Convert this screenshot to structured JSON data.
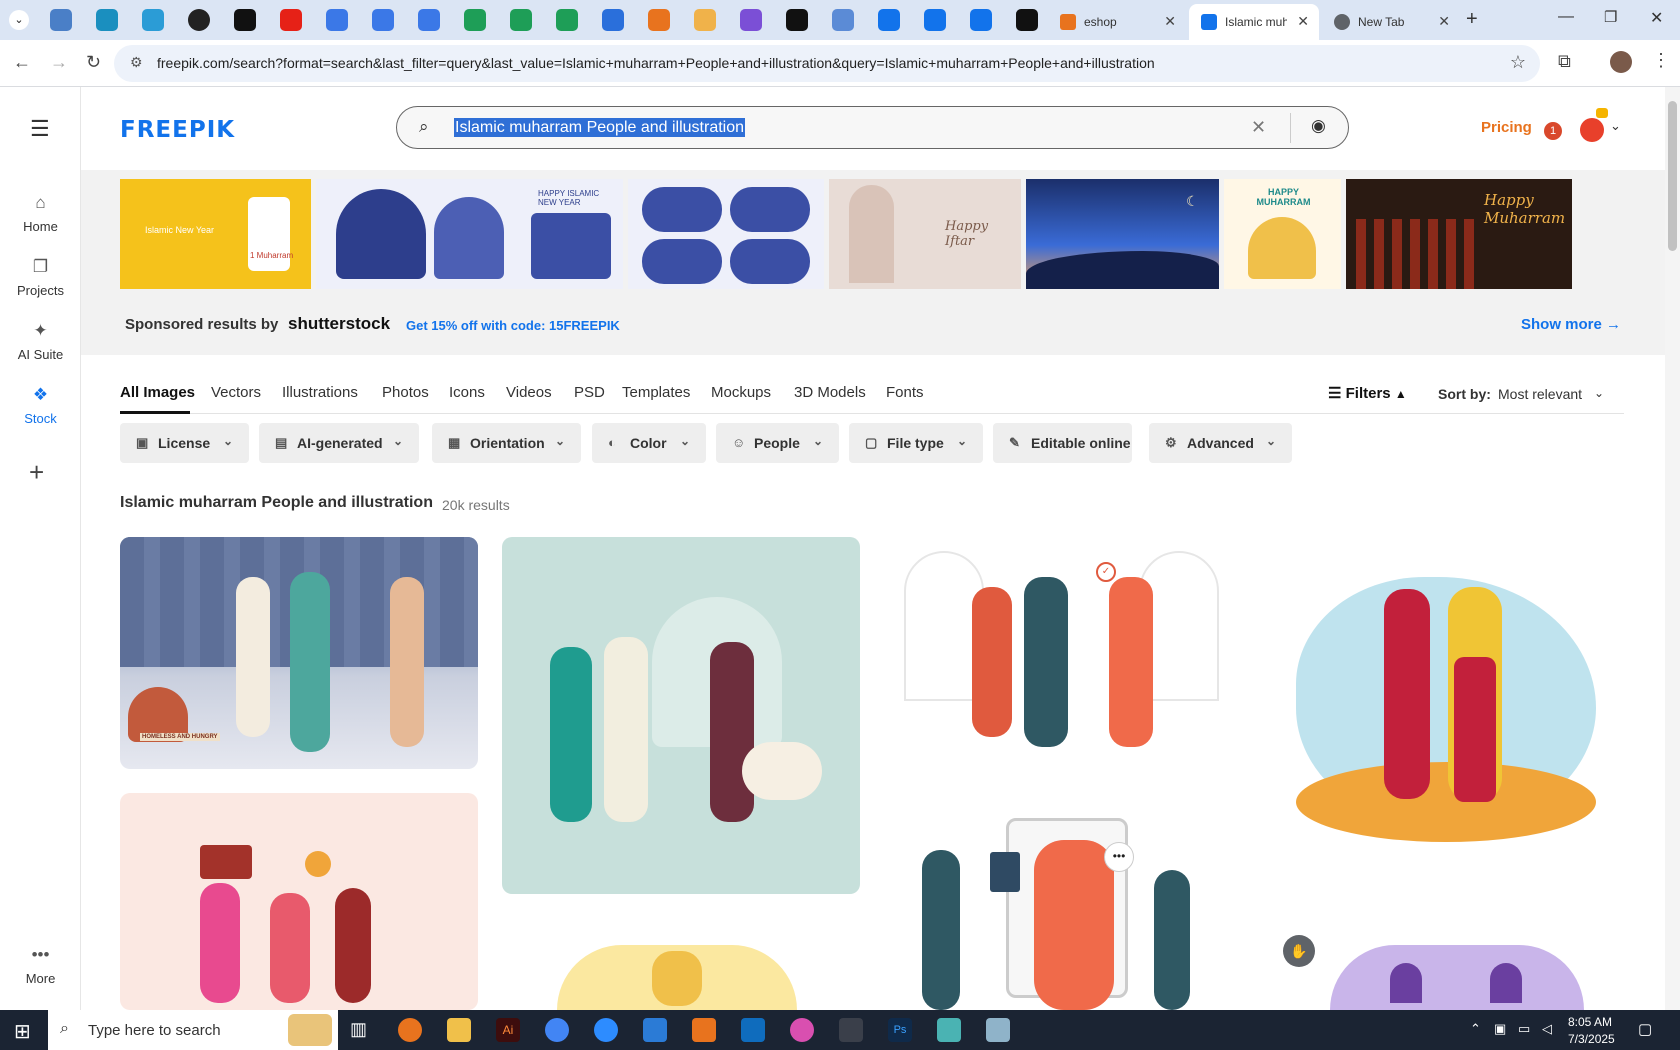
{
  "browser": {
    "tabs": [
      {
        "title": "eshop",
        "color": "#e8731e"
      },
      {
        "title": "Islamic muh",
        "color": "#1273eb"
      },
      {
        "title": "New Tab",
        "color": "#5f6368"
      }
    ],
    "url": "freepik.com/search?format=search&last_filter=query&last_value=Islamic+muharram+People+and+illustration&query=Islamic+muharram+People+and+illustration"
  },
  "rail": {
    "items": [
      {
        "label": "Home",
        "icon": "home-icon"
      },
      {
        "label": "Projects",
        "icon": "projects-icon"
      },
      {
        "label": "AI Suite",
        "icon": "sparkle-icon"
      },
      {
        "label": "Stock",
        "icon": "stock-icon"
      }
    ],
    "more_label": "More"
  },
  "header": {
    "logo": "FREEPIK",
    "search_value": "Islamic muharram People and illustration",
    "pricing": "Pricing",
    "notification_count": "1"
  },
  "sponsor": {
    "label": "Sponsored results by",
    "brand": "shutterstock",
    "promo": "Get 15% off with code: 15FREEPIK",
    "show_more": "Show more →",
    "thumbs": [
      {
        "caption": "Islamic New Year",
        "sub": "1 Muharram",
        "bg": "#f5c21b"
      },
      {
        "caption": "HAPPY ISLAMIC NEW YEAR",
        "sub": "",
        "bg": "#eef0fa"
      },
      {
        "caption": "",
        "sub": "",
        "bg": "#eef0fa"
      },
      {
        "caption": "",
        "sub": "",
        "bg": "#e8dcd6"
      },
      {
        "caption": "Happy Iftar",
        "sub": "",
        "bg": "#e8dcd6"
      },
      {
        "caption": "",
        "sub": "",
        "bg": "#1b2f6b"
      },
      {
        "caption": "HAPPY MUHARRAM",
        "sub": "",
        "bg": "#fff7e6"
      },
      {
        "caption": "Happy Muharram",
        "sub": "",
        "bg": "#2a1a12"
      }
    ]
  },
  "content_tabs": [
    "All Images",
    "Vectors",
    "Illustrations",
    "Photos",
    "Icons",
    "Videos",
    "PSD",
    "Templates",
    "Mockups",
    "3D Models",
    "Fonts"
  ],
  "filters_label": "Filters",
  "sort": {
    "label": "Sort by:",
    "value": "Most relevant"
  },
  "chips": [
    {
      "label": "License",
      "icon": "license-icon"
    },
    {
      "label": "AI-generated",
      "icon": "ai-icon"
    },
    {
      "label": "Orientation",
      "icon": "orientation-icon"
    },
    {
      "label": "Color",
      "icon": "palette-icon"
    },
    {
      "label": "People",
      "icon": "people-icon"
    },
    {
      "label": "File type",
      "icon": "file-icon"
    },
    {
      "label": "Editable online",
      "icon": "pen-icon"
    },
    {
      "label": "Advanced",
      "icon": "gear-icon"
    }
  ],
  "results": {
    "title": "Islamic muharram People and illustration",
    "count": "20k results",
    "card_labels": [
      "HOMELESS AND HUNGRY"
    ]
  },
  "taskbar": {
    "search_placeholder": "Type here to search",
    "time": "8:05 AM",
    "date": "7/3/2025"
  },
  "colors": {
    "accent": "#1273eb",
    "pricing": "#e8731e",
    "taskbar": "#1b2433"
  }
}
